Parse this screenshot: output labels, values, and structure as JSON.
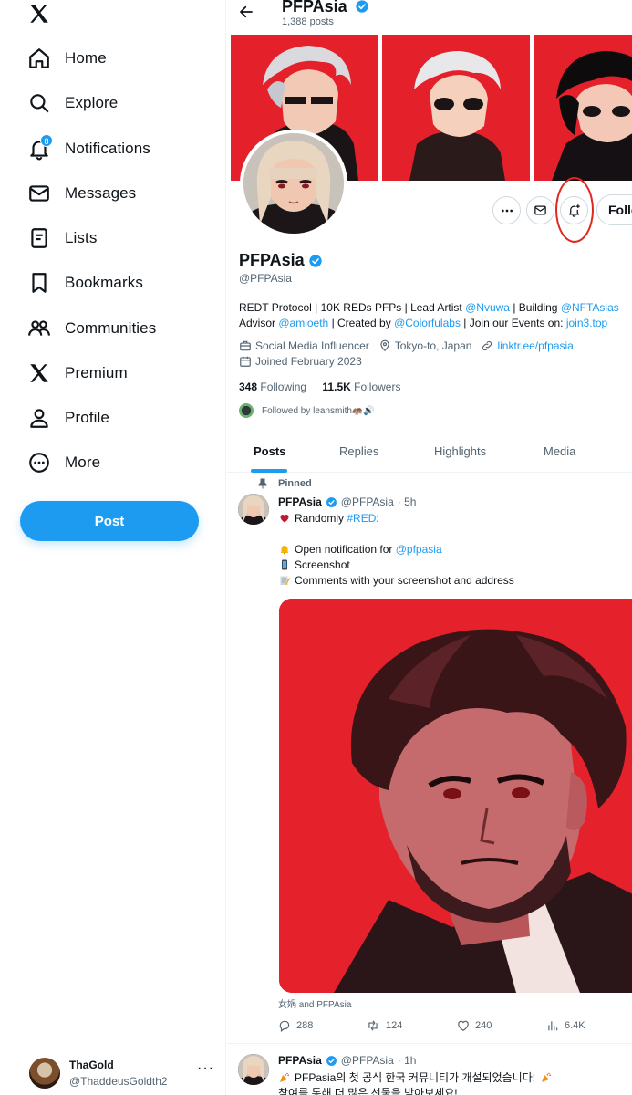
{
  "sidebar": {
    "logo": "x-logo-icon",
    "items": [
      {
        "label": "Home",
        "icon": "home-icon"
      },
      {
        "label": "Explore",
        "icon": "search-icon"
      },
      {
        "label": "Notifications",
        "icon": "bell-icon",
        "badge": "8"
      },
      {
        "label": "Messages",
        "icon": "envelope-icon"
      },
      {
        "label": "Lists",
        "icon": "list-icon"
      },
      {
        "label": "Bookmarks",
        "icon": "bookmark-icon"
      },
      {
        "label": "Communities",
        "icon": "communities-icon"
      },
      {
        "label": "Premium",
        "icon": "x-logo-icon"
      },
      {
        "label": "Profile",
        "icon": "person-icon"
      },
      {
        "label": "More",
        "icon": "more-circle-icon"
      }
    ],
    "post_label": "Post",
    "account": {
      "name": "ThaGold",
      "handle": "@ThaddeusGoldth2",
      "more": "···"
    }
  },
  "header": {
    "title": "PFPAsia",
    "post_count": "1,388 posts"
  },
  "profile": {
    "name": "PFPAsia",
    "handle": "@PFPAsia",
    "follow_label": "Follow",
    "bio": {
      "line1_a": "REDT Protocol | 10K REDs PFPs | Lead Artist ",
      "line1_link1": "@Nvuwa",
      "line1_b": " | Building ",
      "line1_link2": "@NFTAsias",
      "line2_a": "Advisor ",
      "line2_link1": "@amioeth",
      "line2_b": " | Created by ",
      "line2_link2": "@Colorfulabs",
      "line2_c": " | Join our Events on: ",
      "line2_link3": "join3.top"
    },
    "category": "Social Media Influencer",
    "location": "Tokyo-to, Japan",
    "website": "linktr.ee/pfpasia",
    "joined": "Joined February 2023",
    "following_count": "348",
    "following_label": "Following",
    "followers_count": "11.5K",
    "followers_label": "Followers",
    "followed_by": "Followed by leansmith🦛🔊"
  },
  "tabs": [
    "Posts",
    "Replies",
    "Highlights",
    "Media"
  ],
  "tweets": [
    {
      "pinned_label": "Pinned",
      "name": "PFPAsia",
      "handle": "@PFPAsia",
      "time": "· 5h",
      "line1_a": "Randomly ",
      "line1_tag": "#RED",
      "line1_b": ":",
      "line2_a": "Open notification for ",
      "line2_link": "@pfpasia",
      "line3": "Screenshot",
      "line4": "Comments with your screenshot and address",
      "tagged": "女娲 and PFPAsia",
      "replies": "288",
      "reposts": "124",
      "likes": "240",
      "views": "6.4K"
    },
    {
      "name": "PFPAsia",
      "handle": "@PFPAsia",
      "time": "· 1h",
      "line1": "PFPasia의 첫 공식 한국 커뮤니티가 개설되었습니다!",
      "line2": "참여를 통해 더 많은 선물을 받아보세요!"
    }
  ],
  "colors": {
    "accent": "#1d9bf0",
    "banner_red": "#e4202b",
    "annotation_red": "#e0261e"
  }
}
